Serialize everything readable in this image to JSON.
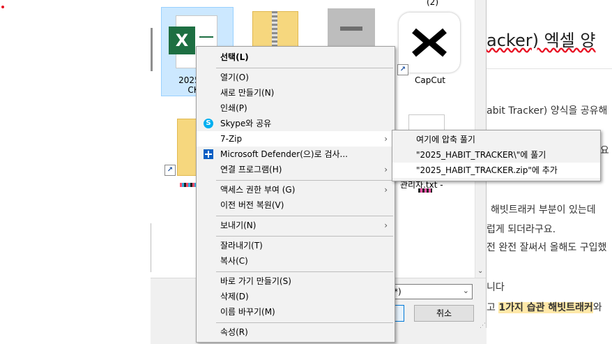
{
  "file_pane": {
    "top_partial_label": "(2)",
    "selected_file_label_line1": "2025_HA",
    "selected_file_label_line2": "CKEI",
    "capcut_label": "CapCut",
    "txt_file_label": "관리자.txt -"
  },
  "dialog": {
    "file_type_value": "*)",
    "cancel_label": "취소"
  },
  "context_menu": {
    "select": "선택(L)",
    "items_group1": [
      "열기(O)",
      "새로 만들기(N)",
      "인쇄(P)",
      "Skype와 공유",
      "7-Zip",
      "Microsoft Defender(으)로 검사...",
      "연결 프로그램(H)"
    ],
    "items_group2": [
      "액세스 권한 부여 (G)",
      "이전 버전 복원(V)"
    ],
    "items_group3": [
      "보내기(N)"
    ],
    "items_group4": [
      "잘라내기(T)",
      "복사(C)"
    ],
    "items_group5": [
      "바로 가기 만들기(S)",
      "삭제(D)",
      "이름 바꾸기(M)"
    ],
    "items_group6": [
      "속성(R)"
    ]
  },
  "zip_submenu": {
    "items": [
      "여기에 압축 풀기",
      "\"2025_HABIT_TRACKER\\\"에 풀기",
      "\"2025_HABIT_TRACKER.zip\"에 추가"
    ]
  },
  "document": {
    "title_part": "acker) 엑셀 양",
    "lines": [
      "abit Tracker) 양식을 공유해",
      "해빗트래커 부분이 있는데",
      "럽게 되더라구요.",
      "전 완전 잘써서 올해도 구입했",
      "니다",
      "고"
    ],
    "highlight": "1가지 습관 해빗트래커",
    "after_highlight": "와",
    "extra_right": "세요"
  }
}
